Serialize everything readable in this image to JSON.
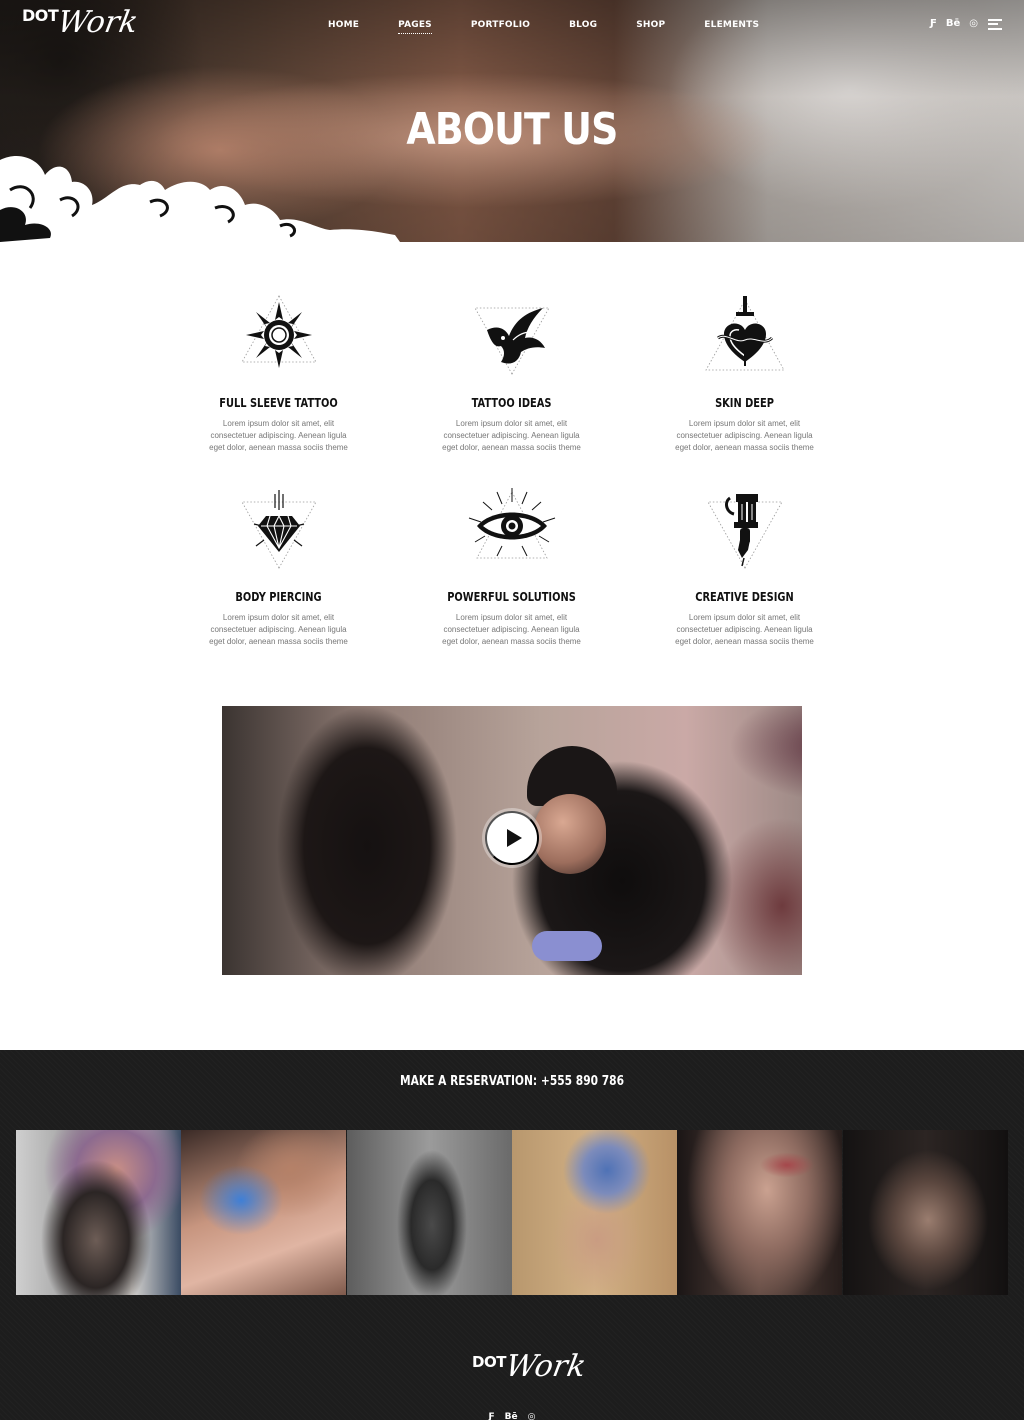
{
  "brand": {
    "logo_dot": "DOT",
    "logo_work": "Work"
  },
  "nav": {
    "items": [
      {
        "label": "HOME",
        "active": false
      },
      {
        "label": "PAGES",
        "active": true
      },
      {
        "label": "PORTFOLIO",
        "active": false
      },
      {
        "label": "BLOG",
        "active": false
      },
      {
        "label": "SHOP",
        "active": false
      },
      {
        "label": "ELEMENTS",
        "active": false
      }
    ],
    "social": [
      {
        "icon": "foursquare-icon",
        "glyph": "Ƒ"
      },
      {
        "icon": "behance-icon",
        "glyph": "Bē"
      },
      {
        "icon": "instagram-icon",
        "glyph": "◎"
      }
    ],
    "menu_icon": "hamburger-menu-icon"
  },
  "hero": {
    "title": "ABOUT US"
  },
  "features": [
    {
      "icon": "sun-icon",
      "title": "FULL SLEEVE TATTOO",
      "desc": "Lorem ipsum dolor sit amet, elit consectetuer adipiscing. Aenean ligula eget dolor, aenean massa sociis theme"
    },
    {
      "icon": "swallow-bird-icon",
      "title": "TATTOO IDEAS",
      "desc": "Lorem ipsum dolor sit amet, elit consectetuer adipiscing. Aenean ligula eget dolor, aenean massa sociis theme"
    },
    {
      "icon": "dagger-heart-icon",
      "title": "SKIN DEEP",
      "desc": "Lorem ipsum dolor sit amet, elit consectetuer adipiscing. Aenean ligula eget dolor, aenean massa sociis theme"
    },
    {
      "icon": "diamond-icon",
      "title": "BODY PIERCING",
      "desc": "Lorem ipsum dolor sit amet, elit consectetuer adipiscing. Aenean ligula eget dolor, aenean massa sociis theme"
    },
    {
      "icon": "eye-icon",
      "title": "POWERFUL SOLUTIONS",
      "desc": "Lorem ipsum dolor sit amet, elit consectetuer adipiscing. Aenean ligula eget dolor, aenean massa sociis theme"
    },
    {
      "icon": "tattoo-machine-icon",
      "title": "CREATIVE DESIGN",
      "desc": "Lorem ipsum dolor sit amet, elit consectetuer adipiscing. Aenean ligula eget dolor, aenean massa sociis theme"
    }
  ],
  "video": {
    "play_icon": "play-icon"
  },
  "footer": {
    "reservation": "MAKE A RESERVATION: +555 890 786",
    "gallery": [
      "tattooed-woman-portrait",
      "tattoo-artist-working",
      "tattooed-man-torso",
      "blue-haired-tattooed-woman",
      "neck-tattoo-closeup",
      "tattooed-man-dark"
    ],
    "logo_dot": "DOT",
    "logo_work": "Work",
    "social": [
      {
        "icon": "foursquare-icon",
        "glyph": "Ƒ"
      },
      {
        "icon": "behance-icon",
        "glyph": "Bē"
      },
      {
        "icon": "instagram-icon",
        "glyph": "◎"
      }
    ]
  }
}
